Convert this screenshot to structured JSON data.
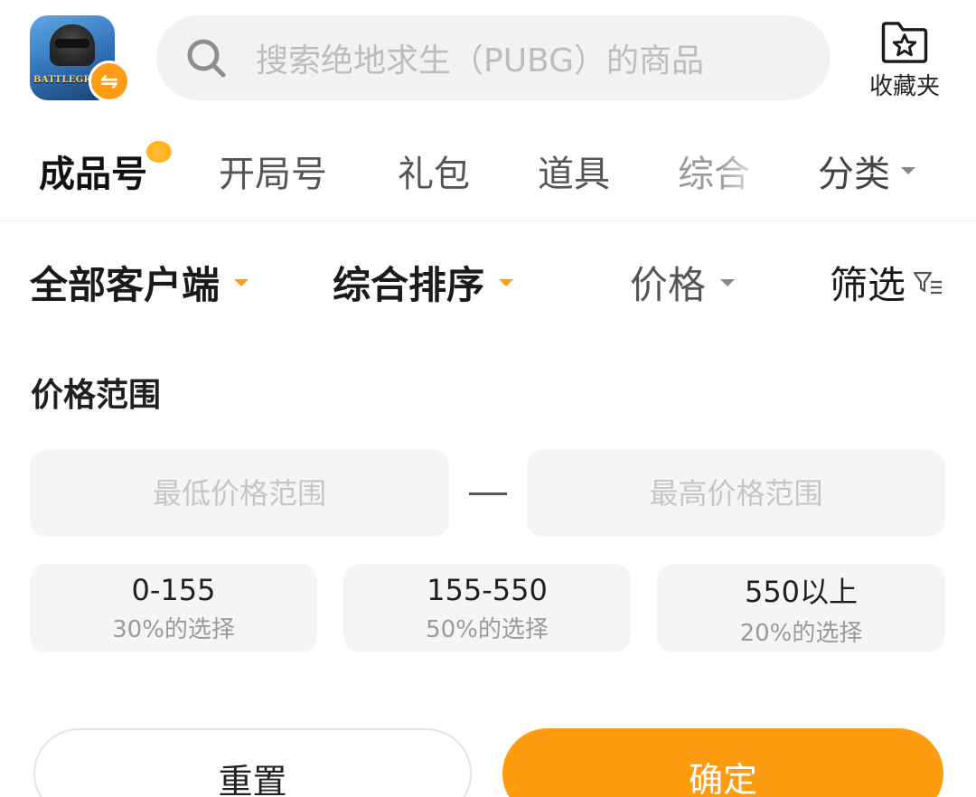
{
  "header": {
    "app_icon": {
      "name": "pubg-app-icon",
      "logo_text": "BATTLEGROUNDS"
    },
    "swap_badge": {
      "icon": "swap-icon",
      "glyph": "⇋"
    },
    "search": {
      "placeholder": "搜索绝地求生（PUBG）的商品"
    },
    "favorites": {
      "label": "收藏夹",
      "icon": "folder-star-icon"
    }
  },
  "tabs": [
    {
      "label": "成品号",
      "active": true
    },
    {
      "label": "开局号",
      "active": false
    },
    {
      "label": "礼包",
      "active": false
    },
    {
      "label": "道具",
      "active": false
    },
    {
      "label": "综合",
      "active": false
    }
  ],
  "category": {
    "label": "分类"
  },
  "filters": {
    "client": "全部客户端",
    "sort": "综合排序",
    "price": "价格",
    "screen": "筛选"
  },
  "price_range": {
    "title": "价格范围",
    "min_placeholder": "最低价格范围",
    "max_placeholder": "最高价格范围",
    "presets": [
      {
        "range": "0-155",
        "percent": "30%的选择"
      },
      {
        "range": "155-550",
        "percent": "50%的选择"
      },
      {
        "range": "550以上",
        "percent": "20%的选择"
      }
    ]
  },
  "actions": {
    "reset": "重置",
    "confirm": "确定"
  },
  "colors": {
    "accent": "#ff9b0f",
    "input_bg": "#f5f5f5",
    "placeholder": "#c6c6c6"
  }
}
